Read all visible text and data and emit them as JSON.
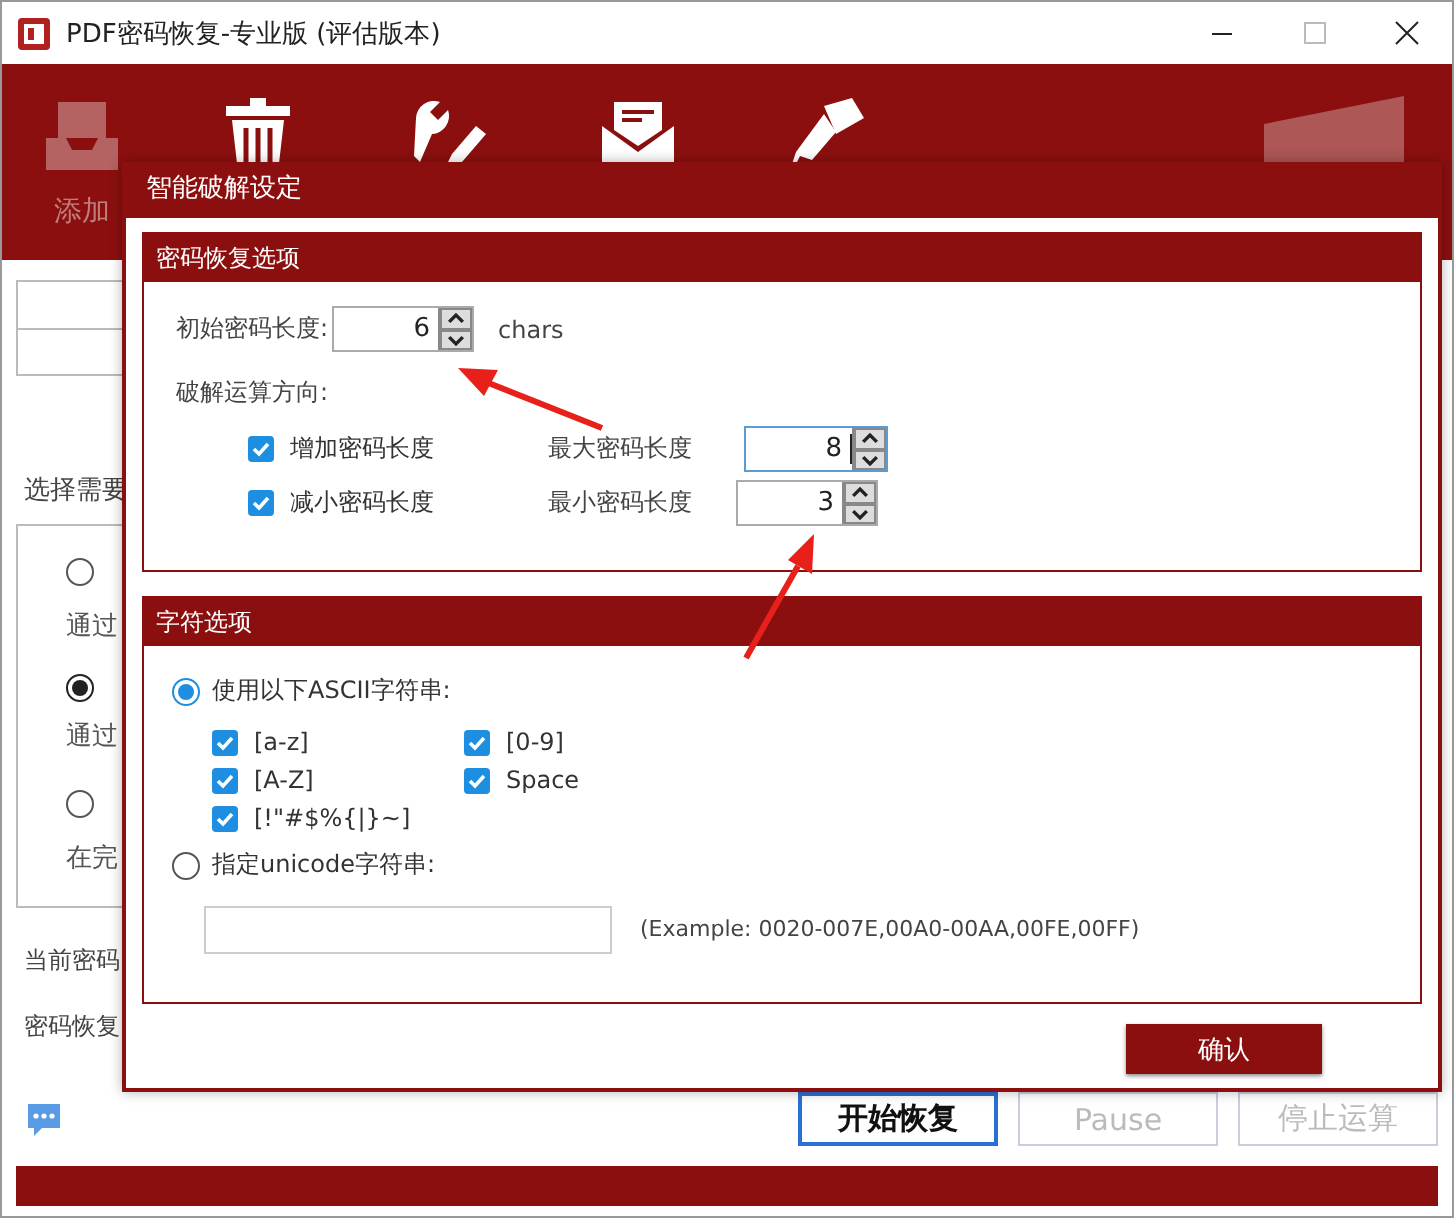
{
  "window": {
    "title": "PDF密码恢复-专业版 (评估版本)"
  },
  "toolbar": {
    "first_label": "添加"
  },
  "main": {
    "prompt": "选择需要",
    "options": [
      {
        "description": "通过",
        "selected": false
      },
      {
        "description": "通过",
        "selected": true
      },
      {
        "description": "在完",
        "selected": false
      }
    ],
    "status_labels": [
      "当前密码",
      "密码恢复"
    ],
    "buttons": [
      {
        "label": "开始恢复",
        "disabled": false
      },
      {
        "label": "Pause",
        "disabled": true
      },
      {
        "label": "停止运算",
        "disabled": true
      }
    ]
  },
  "dialog": {
    "title": "智能破解设定",
    "recovery_group": {
      "title": "密码恢复选项",
      "initial_label": "初始密码长度:",
      "initial_value": "6",
      "unit": "chars",
      "direction_label": "破解运算方向:",
      "directions": [
        {
          "label": "增加密码长度",
          "checked": true,
          "limit_label": "最大密码长度",
          "value": "8",
          "focused": true
        },
        {
          "label": "减小密码长度",
          "checked": true,
          "limit_label": "最小密码长度",
          "value": "3",
          "focused": false
        }
      ]
    },
    "charset_group": {
      "title": "字符选项",
      "ascii": {
        "label": "使用以下ASCII字符串:",
        "selected": true,
        "charsets": [
          {
            "label": "[a-z]",
            "checked": true
          },
          {
            "label": "[0-9]",
            "checked": true
          },
          {
            "label": "[A-Z]",
            "checked": true
          },
          {
            "label": "Space",
            "checked": true
          },
          {
            "label": "[!\"#$%{|}~]",
            "checked": true
          }
        ]
      },
      "unicode": {
        "label": "指定unicode字符串:",
        "selected": false,
        "hint": "(Example: 0020-007E,00A0-00AA,00FE,00FF)"
      }
    },
    "confirm": "确认"
  }
}
